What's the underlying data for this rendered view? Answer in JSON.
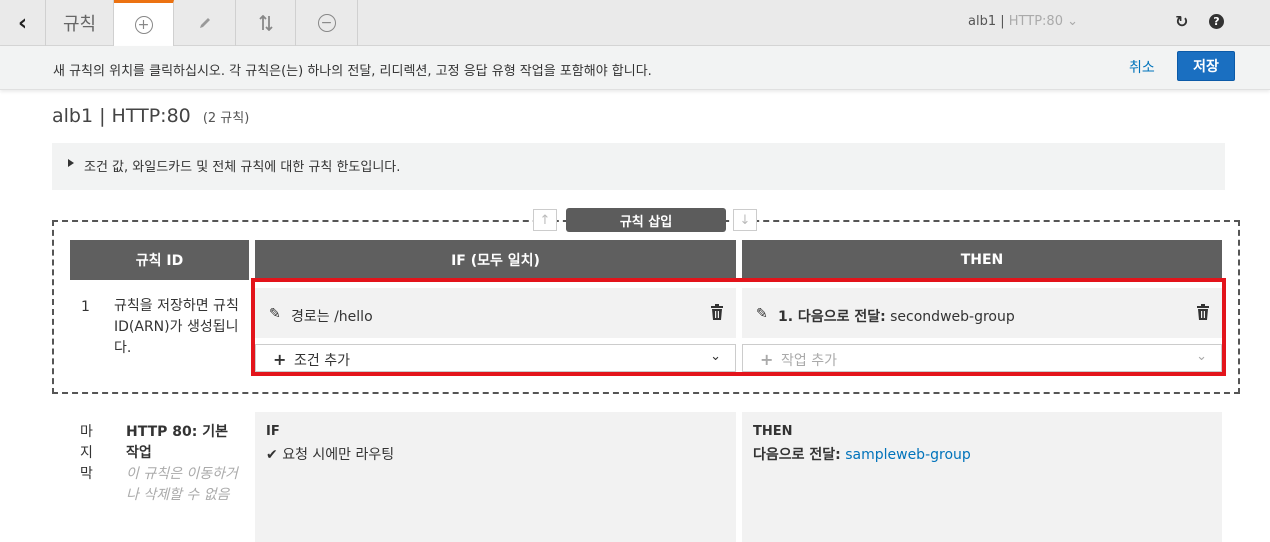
{
  "tabs": {
    "rules_label": "규칙",
    "load_balancer": "alb1",
    "separator": "|",
    "listener": "HTTP:80"
  },
  "infobar": {
    "message": "새 규칙의 위치를 클릭하십시오. 각 규칙은(는) 하나의 전달, 리디렉션, 고정 응답 유형 작업을 포함해야 합니다.",
    "cancel_label": "취소",
    "save_label": "저장"
  },
  "page": {
    "title": "alb1 | HTTP:80",
    "rule_count": "(2 규칙)",
    "limits_text": "조건 값, 와일드카드 및 전체 규칙에 대한 규칙 한도입니다."
  },
  "insert": {
    "label": "규칙 삽입"
  },
  "columns": {
    "rule_id": "규칙 ID",
    "if": "IF (모두 일치)",
    "then": "THEN"
  },
  "rule": {
    "number": "1",
    "note": "규칙을 저장하면 규칙 ID(ARN)가 생성됩니다.",
    "condition": "경로는 /hello",
    "action_prefix": "1. 다음으로 전달:",
    "action_target": "secondweb-group",
    "add_condition": "조건 추가",
    "add_action": "작업 추가"
  },
  "default_rule": {
    "position": "마지막",
    "title": "HTTP 80: 기본 작업",
    "note": "이 규칙은 이동하거나 삭제할 수 없음",
    "if_heading": "IF",
    "if_text": "요청 시에만 라우팅",
    "then_heading": "THEN",
    "then_prefix": "다음으로 전달:",
    "then_target": "sampleweb-group"
  },
  "colors": {
    "accent_orange": "#ec7211",
    "primary_blue": "#1a6fc1",
    "link_blue": "#0073bb",
    "highlight_red": "#e3141b",
    "header_gray": "#5f5f5f"
  }
}
